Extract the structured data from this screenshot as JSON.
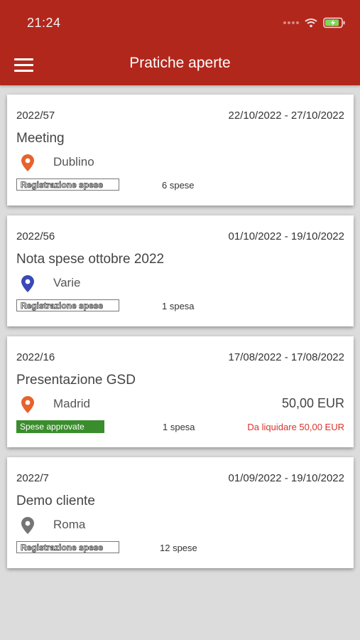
{
  "status_bar": {
    "time": "21:24",
    "icons": [
      "signal-icon",
      "wifi-icon",
      "battery-charging-icon"
    ]
  },
  "app_bar": {
    "title": "Pratiche aperte",
    "menu_icon": "hamburger-menu-icon"
  },
  "colors": {
    "brand": "#b2271c",
    "approved_badge": "#3a8d2c",
    "due_text": "#d9332a",
    "pin_orange": "#e8622c",
    "pin_blue": "#3a49b5",
    "pin_gray": "#757575"
  },
  "cards": [
    {
      "code": "2022/57",
      "dates": "22/10/2022 - 27/10/2022",
      "title": "Meeting",
      "location": "Dublino",
      "pin_color": "#e8622c",
      "amount": "",
      "status": "Registrazione spese",
      "status_style": "outline",
      "count": "6 spese",
      "due": ""
    },
    {
      "code": "2022/56",
      "dates": "01/10/2022 - 19/10/2022",
      "title": "Nota spese ottobre 2022",
      "location": "Varie",
      "pin_color": "#3a49b5",
      "amount": "",
      "status": "Registrazione spese",
      "status_style": "outline",
      "count": "1 spesa",
      "due": ""
    },
    {
      "code": "2022/16",
      "dates": "17/08/2022 - 17/08/2022",
      "title": "Presentazione GSD",
      "location": "Madrid",
      "pin_color": "#e8622c",
      "amount": "50,00 EUR",
      "status": "Spese approvate",
      "status_style": "green",
      "count": "1 spesa",
      "due": "Da liquidare 50,00 EUR"
    },
    {
      "code": "2022/7",
      "dates": "01/09/2022 - 19/10/2022",
      "title": "Demo cliente",
      "location": "Roma",
      "pin_color": "#757575",
      "amount": "",
      "status": "Registrazione spese",
      "status_style": "outline",
      "count": "12 spese",
      "due": ""
    }
  ]
}
